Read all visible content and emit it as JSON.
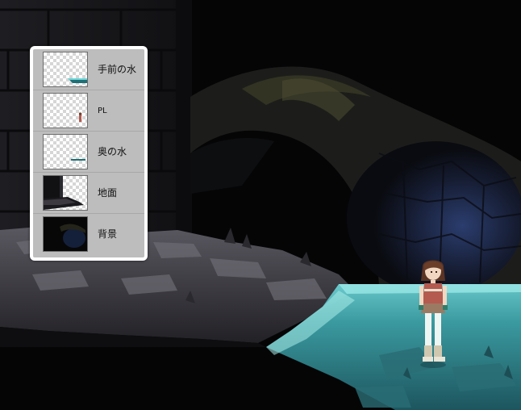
{
  "layers": [
    {
      "label": "手前の水",
      "thumb": "front-water"
    },
    {
      "label": "PL",
      "thumb": "player"
    },
    {
      "label": "奥の水",
      "thumb": "back-water"
    },
    {
      "label": "地面",
      "thumb": "ground"
    },
    {
      "label": "背景",
      "thumb": "background"
    }
  ],
  "colors": {
    "water": "#3fa7ad",
    "water_dark": "#1f6f76",
    "stone": "#3c3a40",
    "cave_blue": "#2c3f70"
  }
}
